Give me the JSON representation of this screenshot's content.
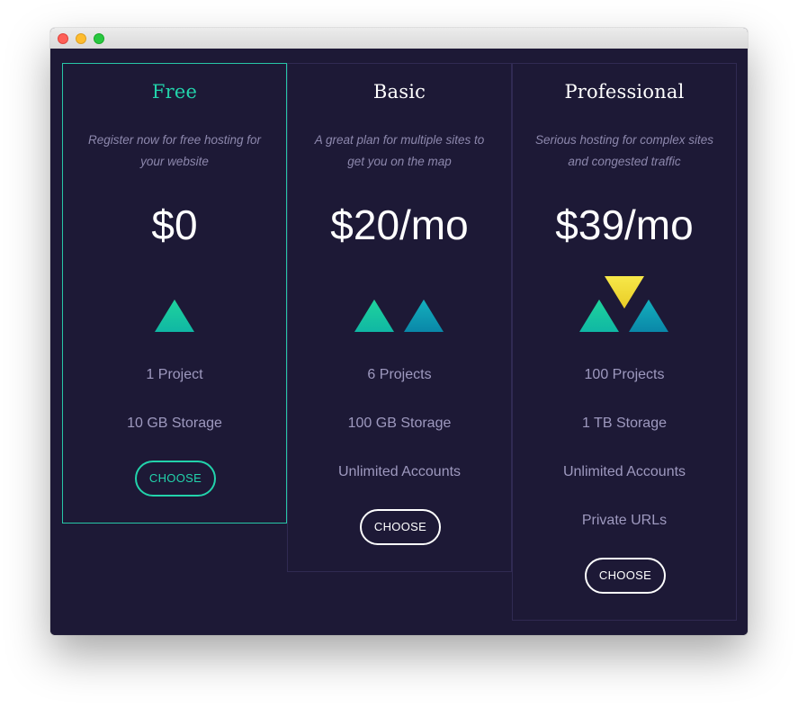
{
  "window": {
    "buttons": [
      "close",
      "minimize",
      "zoom"
    ]
  },
  "plans": [
    {
      "name": "Free",
      "description": "Register now for free hosting for your website",
      "price": "$0",
      "features": [
        "1 Project",
        "10 GB Storage"
      ],
      "button_label": "CHOOSE",
      "highlighted": true,
      "icon": "single-green-triangle"
    },
    {
      "name": "Basic",
      "description": "A great plan for multiple sites to get you on the map",
      "price": "$20/mo",
      "features": [
        "6 Projects",
        "100 GB Storage",
        "Unlimited Accounts"
      ],
      "button_label": "CHOOSE",
      "highlighted": false,
      "icon": "green-and-blue-triangles"
    },
    {
      "name": "Professional",
      "description": "Serious hosting for complex sites and congested traffic",
      "price": "$39/mo",
      "features": [
        "100 Projects",
        "1 TB Storage",
        "Unlimited Accounts",
        "Private URLs"
      ],
      "button_label": "CHOOSE",
      "highlighted": false,
      "icon": "green-blue-yellow-triangles"
    }
  ],
  "colors": {
    "background": "#1d1936",
    "card_border": "#302a52",
    "accent_green": "#22d3ab",
    "text_muted": "#9e99bf",
    "triangle_blue": "#0a9ab8",
    "triangle_yellow": "#f2e23a"
  }
}
